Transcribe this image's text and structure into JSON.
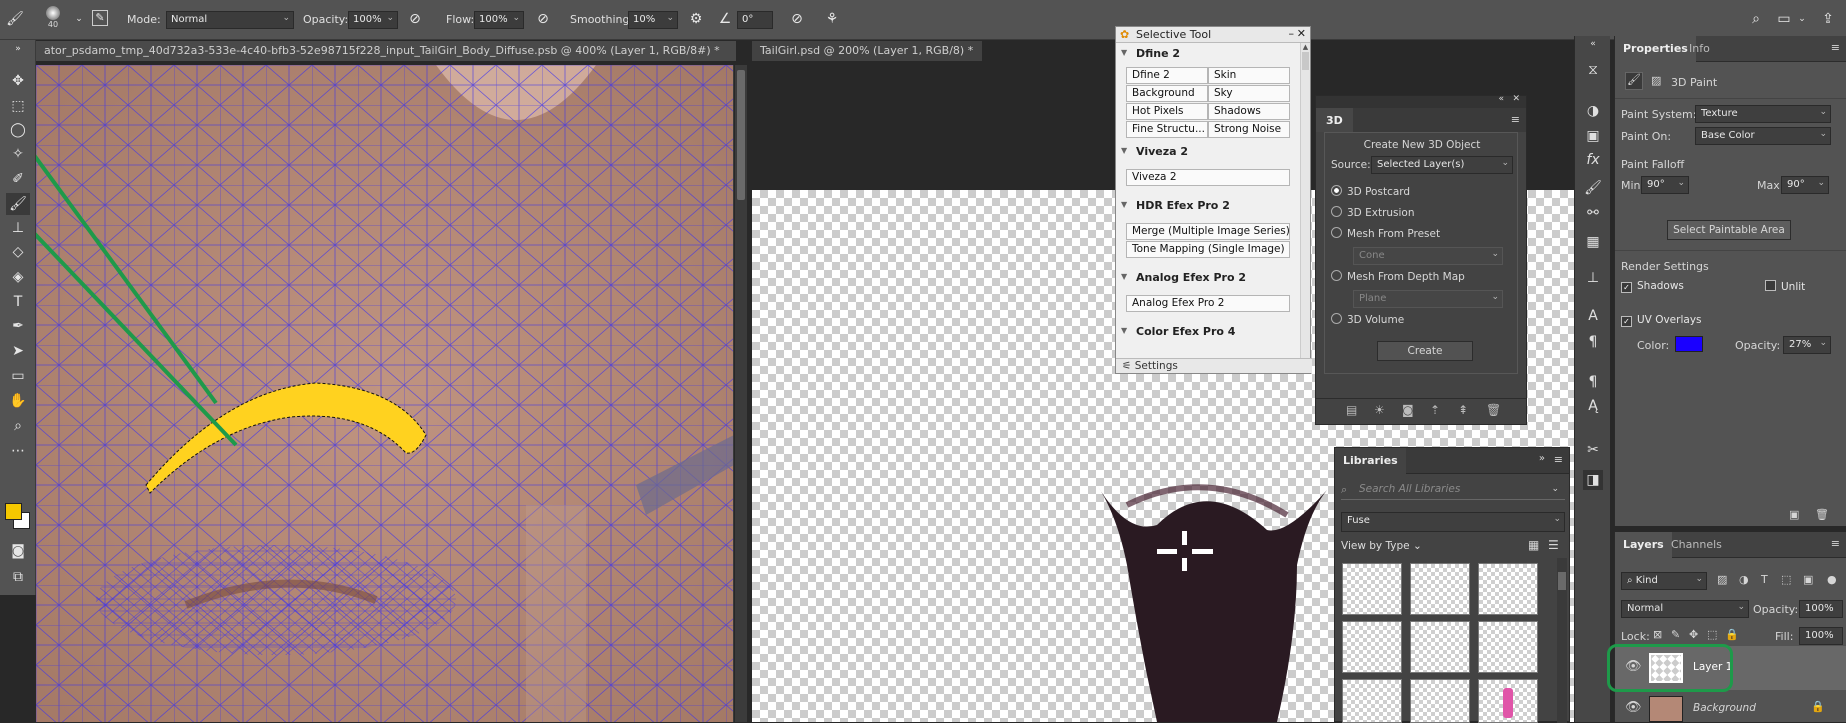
{
  "options_bar": {
    "brush_size": "40",
    "mode_label": "Mode:",
    "mode_value": "Normal",
    "opacity_label": "Opacity:",
    "opacity_value": "100%",
    "flow_label": "Flow:",
    "flow_value": "100%",
    "smoothing_label": "Smoothing:",
    "smoothing_value": "10%",
    "angle_value": "0°"
  },
  "doc_tabs": [
    {
      "title": "ator_psdamo_tmp_40d732a3-533e-4c40-bfb3-52e98715f228_input_TailGirl_Body_Diffuse.psb @ 400% (Layer 1, RGB/8#) *",
      "active": true
    },
    {
      "title": "TailGirl.psd @ 200% (Layer 1, RGB/8) *",
      "active": false
    }
  ],
  "colors": {
    "foreground": "#f5c800",
    "background": "#ffffff",
    "selection": "#ffd21f",
    "annotation_line": "#1e9a4a",
    "mesh": "#3a2ff0",
    "skin": "#b48876",
    "uv_color": "#1a00ff"
  },
  "selective_tool": {
    "title": "Selective Tool",
    "sections": [
      {
        "name": "Dfine 2",
        "buttons": [
          "Dfine 2",
          "Skin",
          "Background",
          "Sky",
          "Hot Pixels",
          "Shadows",
          "Fine Structu...",
          "Strong Noise"
        ]
      },
      {
        "name": "Viveza 2",
        "buttons": [
          "Viveza 2"
        ]
      },
      {
        "name": "HDR Efex Pro 2",
        "buttons": [
          "Merge (Multiple Image Series)",
          "Tone Mapping (Single Image)"
        ]
      },
      {
        "name": "Analog Efex Pro 2",
        "buttons": [
          "Analog Efex Pro 2"
        ]
      },
      {
        "name": "Color Efex Pro 4",
        "buttons": []
      }
    ],
    "settings_label": "Settings"
  },
  "panel_3d": {
    "tab": "3D",
    "heading": "Create New 3D Object",
    "source_label": "Source:",
    "source_value": "Selected Layer(s)",
    "options": [
      "3D Postcard",
      "3D Extrusion",
      "Mesh From Preset",
      "Mesh From Depth Map",
      "3D Volume"
    ],
    "selected_option": "3D Postcard",
    "preset_value": "Cone",
    "depth_value": "Plane",
    "create_button": "Create"
  },
  "libraries": {
    "tab": "Libraries",
    "search_placeholder": "Search All Libraries",
    "library_name": "Fuse",
    "view_by": "View by Type"
  },
  "properties": {
    "tabs": [
      "Properties",
      "Info"
    ],
    "header": "3D Paint",
    "paint_system_label": "Paint System:",
    "paint_system_value": "Texture",
    "paint_on_label": "Paint On:",
    "paint_on_value": "Base Color",
    "paint_falloff": "Paint Falloff",
    "min_label": "Min:",
    "min_value": "90°",
    "max_label": "Max:",
    "max_value": "90°",
    "select_paintable": "Select Paintable Area",
    "render_settings": "Render Settings",
    "shadows": "Shadows",
    "unlit": "Unlit",
    "uv_overlays": "UV Overlays",
    "color_label": "Color:",
    "opacity_label": "Opacity:",
    "opacity_value": "27%"
  },
  "layers_panel": {
    "tabs": [
      "Layers",
      "Channels"
    ],
    "kind_label": "Kind",
    "blend_mode": "Normal",
    "opacity_label": "Opacity:",
    "opacity_value": "100%",
    "lock_label": "Lock:",
    "fill_label": "Fill:",
    "fill_value": "100%",
    "layers": [
      {
        "name": "Layer 1",
        "selected": true
      },
      {
        "name": "Background",
        "selected": false
      }
    ]
  }
}
